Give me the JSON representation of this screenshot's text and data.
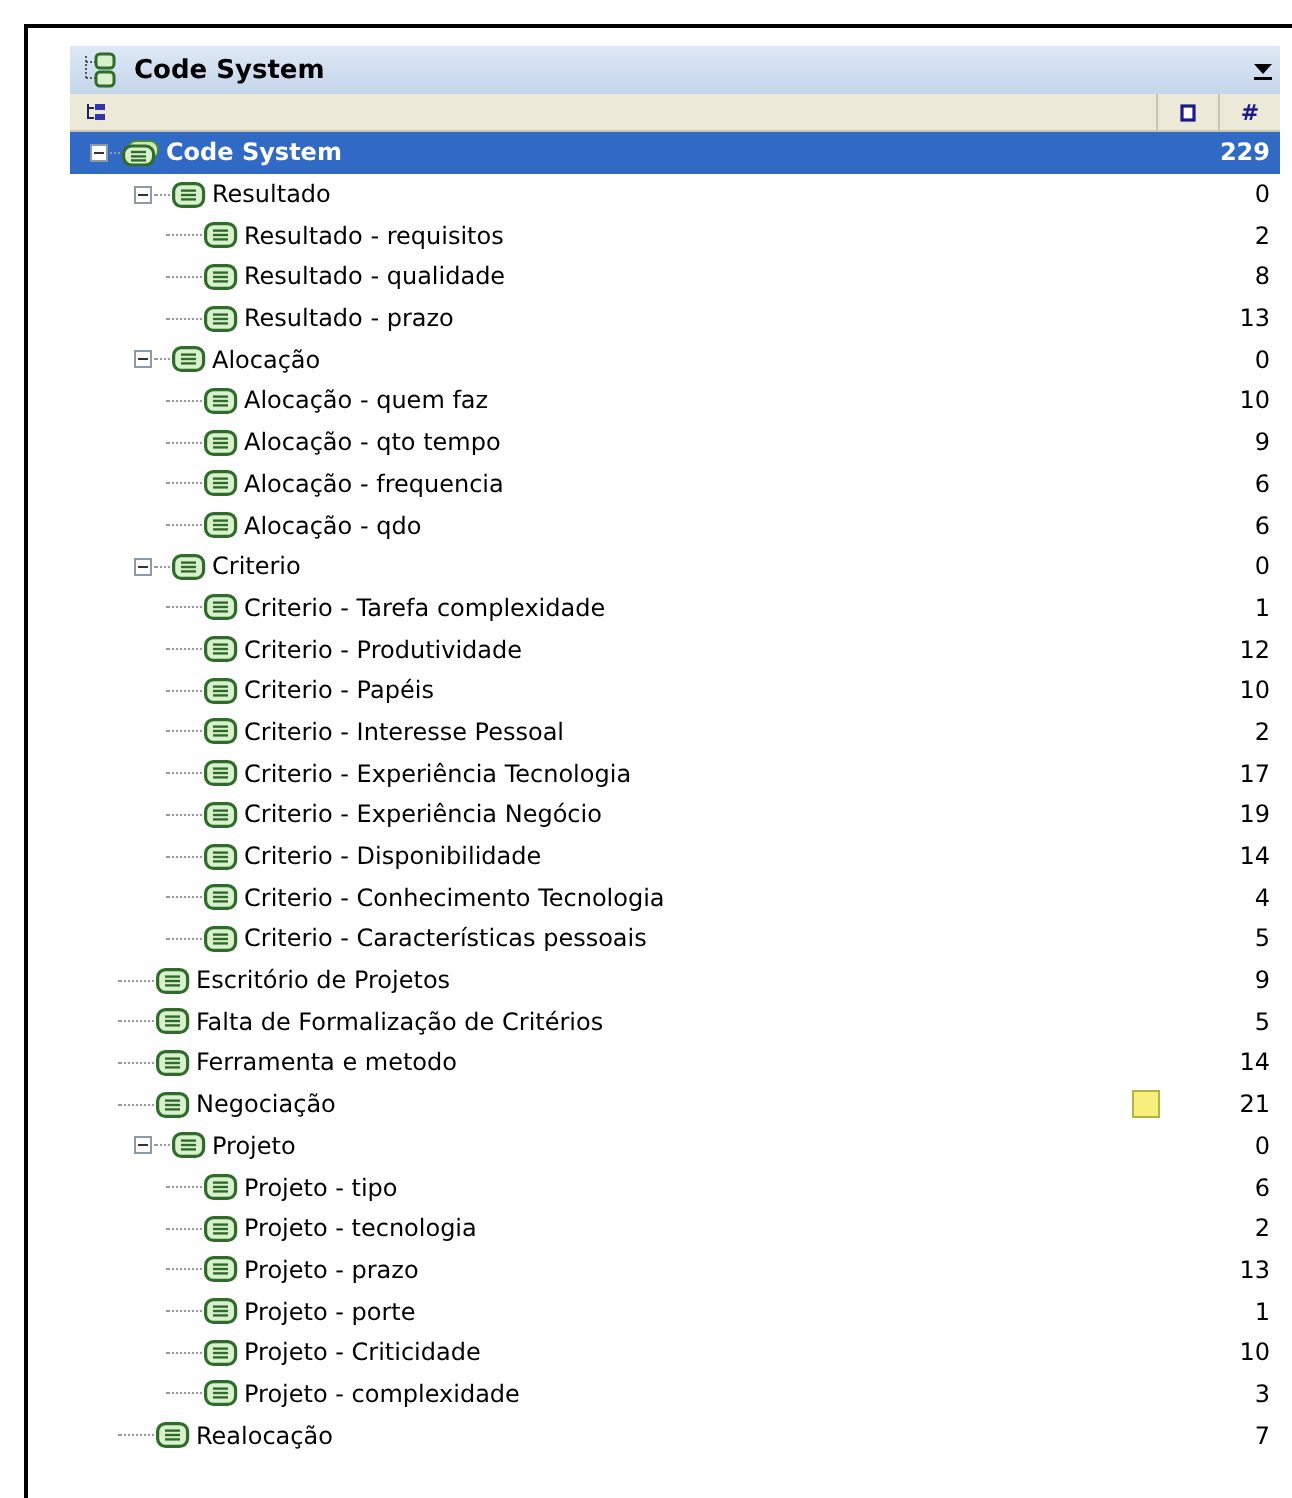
{
  "panel": {
    "title": "Code System",
    "columns": {
      "memo_column_icon": true,
      "count_header": "#"
    }
  },
  "tree": [
    {
      "label": "Code System",
      "count": "229",
      "selected": true,
      "expanded": true,
      "kind": "root",
      "children": [
        {
          "label": "Resultado",
          "count": "0",
          "selected": false,
          "expanded": true,
          "children": [
            {
              "label": "Resultado - requisitos",
              "count": "2",
              "selected": false
            },
            {
              "label": "Resultado - qualidade",
              "count": "8",
              "selected": false
            },
            {
              "label": "Resultado - prazo",
              "count": "13",
              "selected": false
            }
          ]
        },
        {
          "label": "Alocação",
          "count": "0",
          "selected": false,
          "expanded": true,
          "children": [
            {
              "label": "Alocação - quem faz",
              "count": "10",
              "selected": false
            },
            {
              "label": "Alocação - qto tempo",
              "count": "9",
              "selected": false
            },
            {
              "label": "Alocação - frequencia",
              "count": "6",
              "selected": false
            },
            {
              "label": "Alocação - qdo",
              "count": "6",
              "selected": false
            }
          ]
        },
        {
          "label": "Criterio",
          "count": "0",
          "selected": false,
          "expanded": true,
          "children": [
            {
              "label": "Criterio - Tarefa complexidade",
              "count": "1",
              "selected": false
            },
            {
              "label": "Criterio - Produtividade",
              "count": "12",
              "selected": false
            },
            {
              "label": "Criterio - Papéis",
              "count": "10",
              "selected": false
            },
            {
              "label": "Criterio - Interesse Pessoal",
              "count": "2",
              "selected": false
            },
            {
              "label": "Criterio - Experiência Tecnologia",
              "count": "17",
              "selected": false
            },
            {
              "label": "Criterio - Experiência Negócio",
              "count": "19",
              "selected": false
            },
            {
              "label": "Criterio - Disponibilidade",
              "count": "14",
              "selected": false
            },
            {
              "label": "Criterio - Conhecimento Tecnologia",
              "count": "4",
              "selected": false
            },
            {
              "label": "Criterio - Características pessoais",
              "count": "5",
              "selected": false
            }
          ]
        },
        {
          "label": "Escritório de Projetos",
          "count": "9",
          "selected": false
        },
        {
          "label": "Falta de Formalização de Critérios",
          "count": "5",
          "selected": false
        },
        {
          "label": "Ferramenta e metodo",
          "count": "14",
          "selected": false
        },
        {
          "label": "Negociação",
          "count": "21",
          "selected": false,
          "memo": true
        },
        {
          "label": "Projeto",
          "count": "0",
          "selected": false,
          "expanded": true,
          "children": [
            {
              "label": "Projeto - tipo",
              "count": "6",
              "selected": false
            },
            {
              "label": "Projeto - tecnologia",
              "count": "2",
              "selected": false
            },
            {
              "label": "Projeto - prazo",
              "count": "13",
              "selected": false
            },
            {
              "label": "Projeto - porte",
              "count": "1",
              "selected": false
            },
            {
              "label": "Projeto - Criticidade",
              "count": "10",
              "selected": false
            },
            {
              "label": "Projeto - complexidade",
              "count": "3",
              "selected": false
            }
          ]
        },
        {
          "label": "Realocação",
          "count": "7",
          "selected": false
        }
      ]
    }
  ]
}
